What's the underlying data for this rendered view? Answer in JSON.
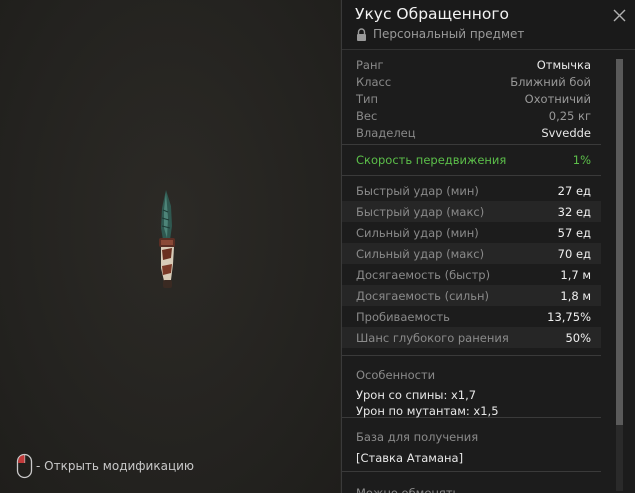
{
  "viewport": {
    "hint": "- Открыть модификацию",
    "mouse_icon": "mouse-icon",
    "item_icon": "knife-icon"
  },
  "panel": {
    "title": "Укус Обращенного",
    "subtitle": "Персональный предмет",
    "close_icon": "close-icon",
    "lock_icon": "lock-icon",
    "info": [
      {
        "label": "Ранг",
        "value": "Отмычка"
      },
      {
        "label": "Класс",
        "value": "Ближний бой"
      },
      {
        "label": "Тип",
        "value": "Охотничий"
      },
      {
        "label": "Вес",
        "value": "0,25 кг"
      },
      {
        "label": "Владелец",
        "value": "Svvedde"
      }
    ],
    "speed": {
      "label": "Скорость передвижения",
      "value": "1%",
      "color": "#5cbf4a"
    },
    "stats": [
      {
        "label": "Быстрый удар (мин)",
        "value": "27 ед"
      },
      {
        "label": "Быстрый удар (макс)",
        "value": "32 ед"
      },
      {
        "label": "Сильный удар (мин)",
        "value": "57 ед"
      },
      {
        "label": "Сильный удар (макс)",
        "value": "70 ед"
      },
      {
        "label": "Досягаемость (быстр)",
        "value": "1,7 м"
      },
      {
        "label": "Досягаемость (сильн)",
        "value": "1,8 м"
      },
      {
        "label": "Пробиваемость",
        "value": "13,75%"
      },
      {
        "label": "Шанс глубокого ранения",
        "value": "50%"
      }
    ],
    "features": {
      "heading": "Особенности",
      "lines": [
        "Урон со спины: x1,7",
        "Урон по мутантам: x1,5"
      ]
    },
    "origin": {
      "heading": "База для получения",
      "value": "[Ставка Атамана]"
    },
    "trade": "Можно обменять"
  }
}
